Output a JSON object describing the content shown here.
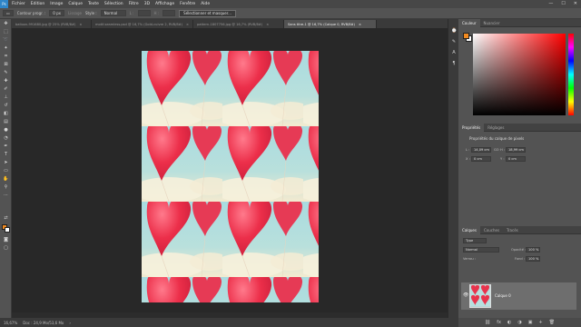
{
  "menu": {
    "app_logo": "Ps",
    "items": [
      "Fichier",
      "Edition",
      "Image",
      "Calque",
      "Texte",
      "Sélection",
      "Filtre",
      "3D",
      "Affichage",
      "Fenêtre",
      "Aide"
    ]
  },
  "window_controls": {
    "minimize": "—",
    "maximize": "☐",
    "close": "✕"
  },
  "options_bar": {
    "tool": "▭",
    "contour_label": "Contour progr. :",
    "contour_value": "0 px",
    "lisse_label": "Lissage",
    "style_label": "Style :",
    "style_value": "Normal",
    "width_label": "L :",
    "height_label": "H :",
    "select_button": "Sélectionner et masquer..."
  },
  "doc_tabs": [
    {
      "label": "balloon-991680.jpg @ 25% (RVB/8#)",
      "active": false,
      "close": "×"
    },
    {
      "label": "motif-seamless.psd @ 16,7% (Gold-cuivre 2, RVB/8#)",
      "active": false,
      "close": "×"
    },
    {
      "label": "pattern-1807756.jpg @ 16,7% (RVB/8#)",
      "active": false,
      "close": "×"
    },
    {
      "label": "Sans titre-1 @ 16,7% (Calque 0, RVB/8#)",
      "active": true,
      "close": "×"
    }
  ],
  "status": {
    "zoom": "16,67%",
    "doc": "Doc : 24,9 Mo/53,6 Mo",
    "arrow": "›"
  },
  "color_panel": {
    "tabs": [
      "Couleur",
      "Nuancier"
    ]
  },
  "properties_panel": {
    "tabs": [
      "Propriétés",
      "Réglages"
    ],
    "title": "Propriétés du calque de pixels",
    "w_label": "L :",
    "w_value": "14,09 cm",
    "go_label": "GO",
    "h_label": "H :",
    "h_value": "18,99 cm",
    "x_label": "X :",
    "x_value": "0 cm",
    "y_label": "Y :",
    "y_value": "0 cm"
  },
  "layers_panel": {
    "tabs": [
      "Calques",
      "Couches",
      "Tracés"
    ],
    "filter_value": "Type",
    "blend_value": "Normal",
    "opacity_label": "Opacité :",
    "opacity_value": "100 %",
    "lock_label": "Verrou :",
    "fill_label": "Fond :",
    "fill_value": "100 %",
    "layer_name": "Calque 0",
    "footer_icons": [
      "⛓",
      "fx",
      "◐",
      "◑",
      "▣",
      "+",
      "🗑"
    ]
  },
  "colors": {
    "foreground": "#f28a1f",
    "background": "#ffffff",
    "balloon": "#e8344d",
    "sky": "#9fd3d6"
  }
}
